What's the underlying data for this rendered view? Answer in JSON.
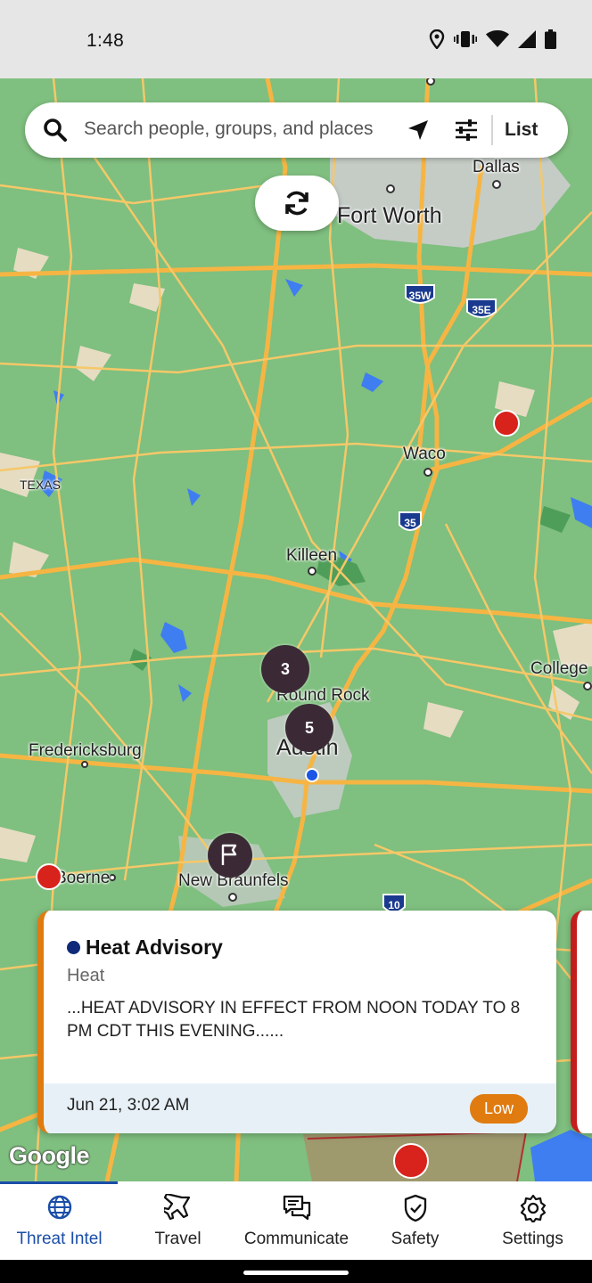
{
  "status_bar": {
    "time": "1:48",
    "icons": [
      "location-icon",
      "vibrate-icon",
      "wifi-icon",
      "signal-icon",
      "battery-icon"
    ]
  },
  "search": {
    "placeholder": "Search people, groups, and places",
    "list_label": "List"
  },
  "map": {
    "labels": {
      "dallas": "Dallas",
      "fort_worth": "Fort Worth",
      "waco": "Waco",
      "texas": "TEXAS",
      "killeen": "Killeen",
      "round_rock": "Round Rock",
      "college": "College",
      "austin": "Austin",
      "fredericksburg": "Fredericksburg",
      "boerne": "Boerne",
      "new_braunfels": "New Braunfels"
    },
    "shields": {
      "i35w": "35W",
      "i35e": "35E",
      "i35": "35",
      "i10": "10"
    },
    "clusters": {
      "north": "3",
      "austin": "5"
    },
    "attribution": "Google",
    "colors": {
      "land": "#7fbf7f",
      "roads": "#f6b543",
      "alert_marker": "#d8221c",
      "cluster": "#3b2a36"
    }
  },
  "alert_card": {
    "title": "Heat Advisory",
    "category": "Heat",
    "body": "...HEAT ADVISORY IN EFFECT FROM NOON TODAY TO 8 PM CDT THIS EVENING......",
    "timestamp": "Jun 21, 3:02 AM",
    "severity": "Low",
    "severity_color": "#e07b10"
  },
  "tabs": [
    {
      "label": "Threat Intel",
      "icon": "globe-icon",
      "active": true
    },
    {
      "label": "Travel",
      "icon": "airplane-icon",
      "active": false
    },
    {
      "label": "Communicate",
      "icon": "chat-icon",
      "active": false
    },
    {
      "label": "Safety",
      "icon": "shield-check-icon",
      "active": false
    },
    {
      "label": "Settings",
      "icon": "gear-icon",
      "active": false
    }
  ]
}
